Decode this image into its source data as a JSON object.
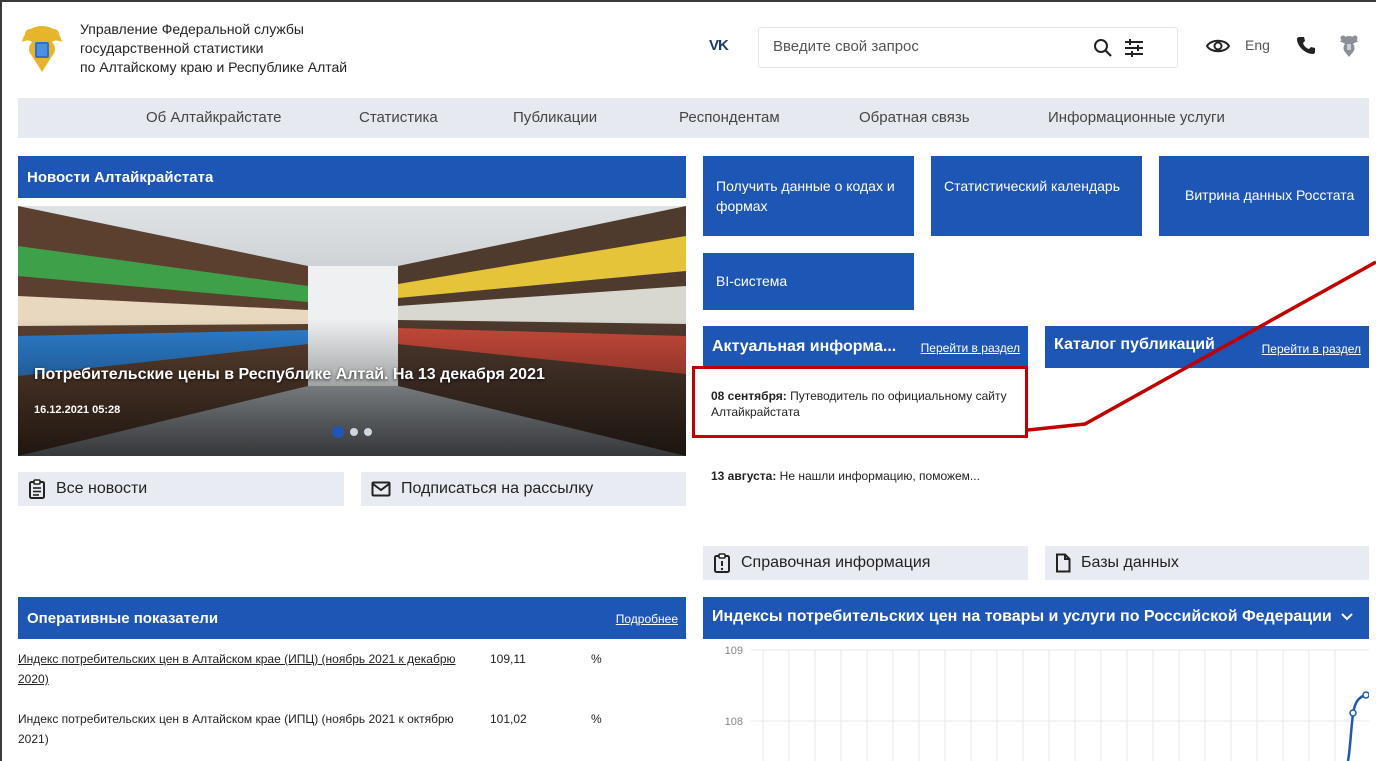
{
  "header": {
    "org_line1": "Управление Федеральной службы",
    "org_line2": "государственной статистики",
    "org_line3": "по Алтайскому краю и Республике Алтай",
    "vk": "VK",
    "search_placeholder": "Введите свой запрос",
    "lang": "Eng"
  },
  "nav": {
    "items": [
      "Об Алтайкрайстате",
      "Статистика",
      "Публикации",
      "Респондентам",
      "Обратная связь",
      "Информационные услуги"
    ]
  },
  "news": {
    "title": "Новости Алтайкрайстата",
    "slide_title": "Потребительские цены в Республике Алтай. На 13 декабря 2021",
    "slide_date": "16.12.2021 05:28",
    "all_news": "Все новости",
    "subscribe": "Подписаться на рассылку"
  },
  "tiles": {
    "codes": "Получить данные о кодах и формах",
    "calendar": "Статистический календарь",
    "vitrina": "Витрина данных Росстата",
    "bi": "BI-система"
  },
  "actual": {
    "title": "Актуальная информа...",
    "more": "Перейти в раздел",
    "items": [
      {
        "date": "08 сентября:",
        "text": " Путеводитель по официальному сайту Алтайкрайстата"
      },
      {
        "date": "13 августа:",
        "text": " Не нашли информацию, поможем..."
      }
    ]
  },
  "catalog": {
    "title": "Каталог публикаций",
    "more": "Перейти в раздел"
  },
  "reference": {
    "spr": "Справочная информация",
    "bazy": "Базы данных"
  },
  "operative": {
    "title": "Оперативные показатели",
    "more": "Подробнее",
    "rows": [
      {
        "name": "Индекс потребительских цен в Алтайском крае (ИПЦ) (ноябрь 2021 к декабрю 2020)",
        "value": "109,11",
        "unit": "%"
      },
      {
        "name": "Индекс потребительских цен в Алтайском крае (ИПЦ) (ноябрь 2021 к октябрю 2021)",
        "value": "101,02",
        "unit": "%"
      }
    ]
  },
  "cpi": {
    "title": "Индексы потребительских цен на товары и услуги по Российской Федерации",
    "y_labels": [
      "109",
      "108"
    ]
  },
  "colors": {
    "brand_blue": "#1e56b5",
    "nav_gray": "#e6eaf0",
    "highlight_red": "#c00000"
  }
}
